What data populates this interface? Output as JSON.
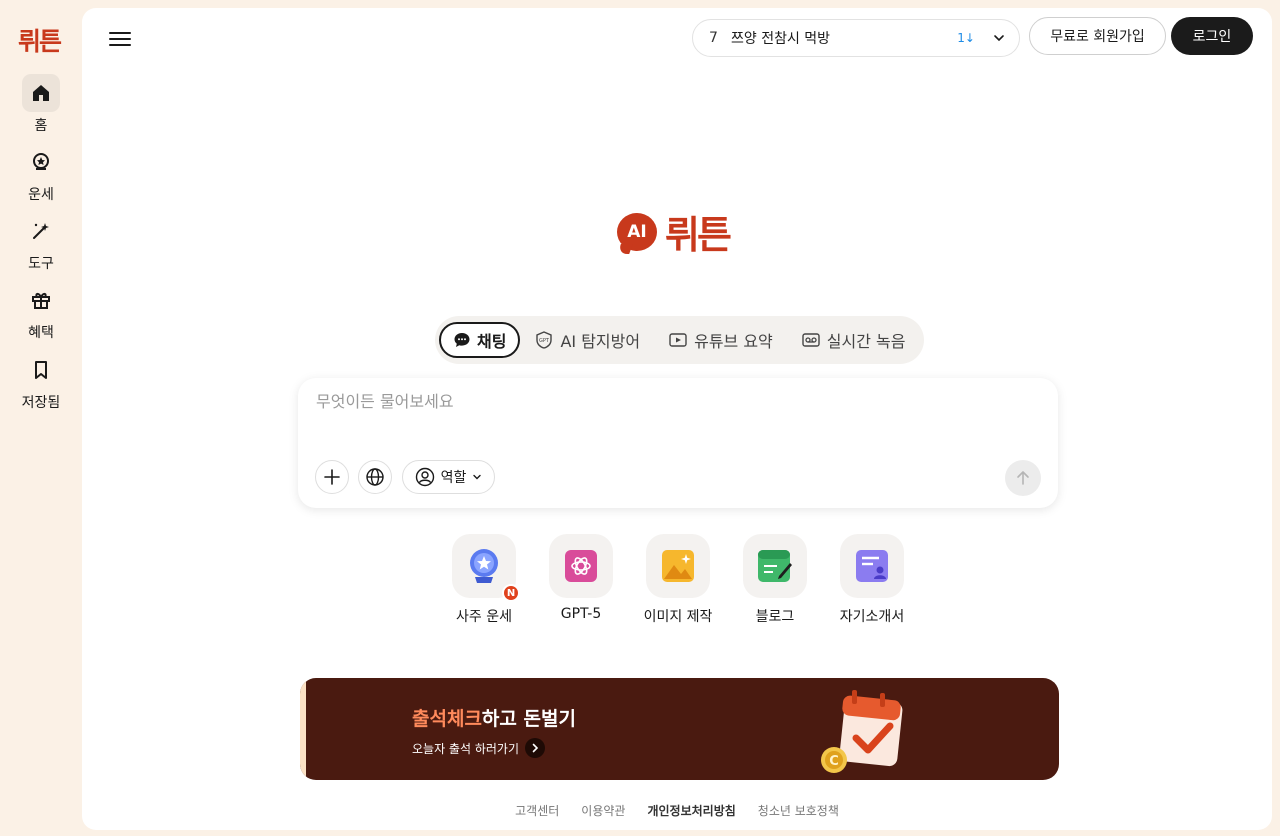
{
  "rail": {
    "logo": "뤼튼",
    "items": [
      {
        "label": "홈",
        "icon": "home-icon"
      },
      {
        "label": "운세",
        "icon": "fortune-icon"
      },
      {
        "label": "도구",
        "icon": "magic-wand-icon"
      },
      {
        "label": "혜택",
        "icon": "gift-icon"
      },
      {
        "label": "저장됨",
        "icon": "bookmark-icon"
      }
    ]
  },
  "header": {
    "trending": {
      "rank": "7",
      "text": "쯔양 전참시 먹방",
      "delta": "1↓"
    },
    "signup_label": "무료로 회원가입",
    "login_label": "로그인"
  },
  "brand": {
    "badge": "AI",
    "name": "뤼튼",
    "color": "#c8391c"
  },
  "tabs": [
    {
      "label": "채팅",
      "icon": "chat-icon",
      "active": true
    },
    {
      "label": "AI 탐지방어",
      "icon": "gpt-shield-icon",
      "active": false
    },
    {
      "label": "유튜브 요약",
      "icon": "play-icon",
      "active": false
    },
    {
      "label": "실시간 녹음",
      "icon": "recorder-icon",
      "active": false
    }
  ],
  "composer": {
    "placeholder": "무엇이든 물어보세요",
    "role_label": "역할"
  },
  "tools": [
    {
      "label": "사주 운세",
      "icon": "crystal-ball-icon",
      "badge": "N"
    },
    {
      "label": "GPT-5",
      "icon": "gpt-logo-icon"
    },
    {
      "label": "이미지 제작",
      "icon": "image-icon"
    },
    {
      "label": "블로그",
      "icon": "blog-icon"
    },
    {
      "label": "자기소개서",
      "icon": "resume-icon"
    }
  ],
  "banner": {
    "title_highlight": "출석체크",
    "title_rest": "하고 돈벌기",
    "subtitle": "오늘자 출석 하러가기"
  },
  "footer": {
    "links": [
      "고객센터",
      "이용약관",
      "개인정보처리방침",
      "청소년 보호정책"
    ]
  }
}
